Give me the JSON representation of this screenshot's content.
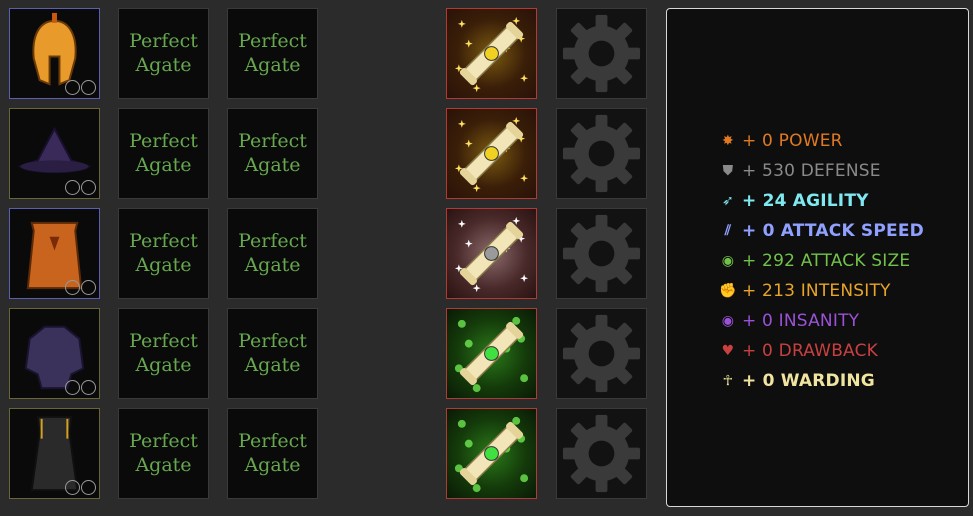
{
  "equipment": [
    {
      "name": "helmet",
      "sockets": 2
    },
    {
      "name": "wizard-hat",
      "sockets": 2
    },
    {
      "name": "cape",
      "sockets": 2
    },
    {
      "name": "chest-armor",
      "sockets": 2
    },
    {
      "name": "robe-legs",
      "sockets": 2
    }
  ],
  "gems": [
    [
      "Perfect Agate",
      "Perfect Agate"
    ],
    [
      "Perfect Agate",
      "Perfect Agate"
    ],
    [
      "Perfect Agate",
      "Perfect Agate"
    ],
    [
      "Perfect Agate",
      "Perfect Agate"
    ],
    [
      "Perfect Agate",
      "Perfect Agate"
    ]
  ],
  "scrolls": [
    {
      "variant": "gold",
      "gem_color": "#f0d020"
    },
    {
      "variant": "gold",
      "gem_color": "#f0d020"
    },
    {
      "variant": "silver",
      "gem_color": "#9a9a9a"
    },
    {
      "variant": "green",
      "gem_color": "#40e040"
    },
    {
      "variant": "green",
      "gem_color": "#40e040"
    }
  ],
  "stats": [
    {
      "text": "+ 0 POWER",
      "color": "#e07a22",
      "icon": "burst-icon",
      "glyph": "✸",
      "bold": false
    },
    {
      "text": "+ 530 DEFENSE",
      "color": "#8a8a8a",
      "icon": "shield-icon",
      "glyph": "⛊",
      "bold": false
    },
    {
      "text": "+ 24 AGILITY",
      "color": "#7fe8f0",
      "icon": "running-icon",
      "glyph": "➶",
      "bold": true
    },
    {
      "text": "+ 0 ATTACK SPEED",
      "color": "#8fa0ff",
      "icon": "slash-icon",
      "glyph": "⫽",
      "bold": true
    },
    {
      "text": "+ 292 ATTACK SIZE",
      "color": "#72c24a",
      "icon": "planet-icon",
      "glyph": "◉",
      "bold": false
    },
    {
      "text": "+ 213 INTENSITY",
      "color": "#e8a52a",
      "icon": "fist-icon",
      "glyph": "✊",
      "bold": false
    },
    {
      "text": "+ 0 INSANITY",
      "color": "#9a52d8",
      "icon": "eye-icon",
      "glyph": "◉",
      "bold": false
    },
    {
      "text": "+ 0 DRAWBACK",
      "color": "#c84040",
      "icon": "broken-heart-icon",
      "glyph": "♥",
      "bold": false
    },
    {
      "text": "+ 0 WARDING",
      "color": "#f0e4a0",
      "icon": "ankh-icon",
      "glyph": "☥",
      "bold": true
    }
  ]
}
